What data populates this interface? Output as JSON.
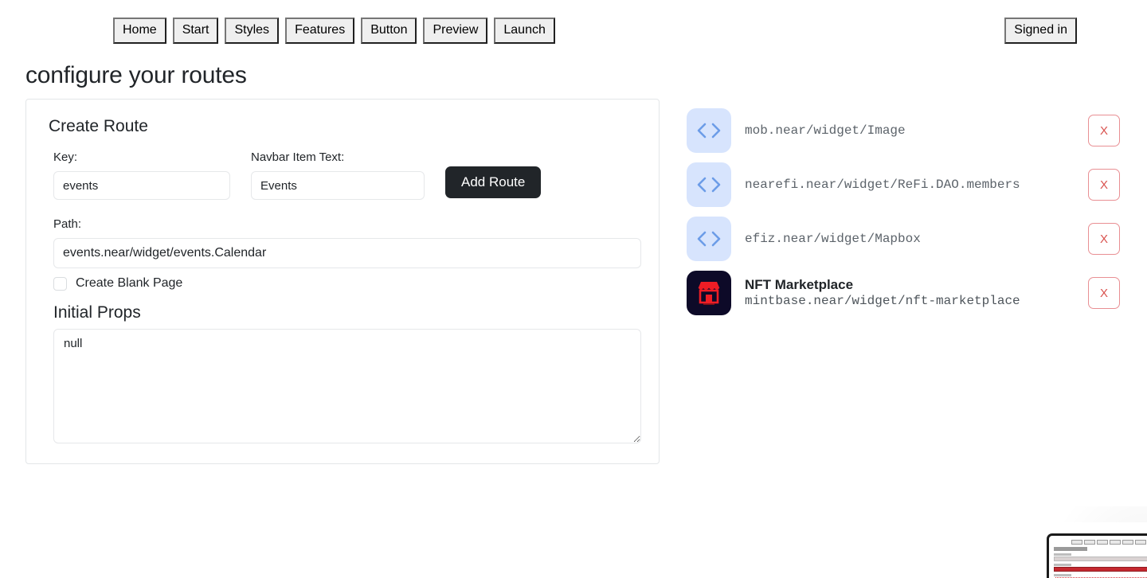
{
  "nav": {
    "items": [
      {
        "label": "Home"
      },
      {
        "label": "Start"
      },
      {
        "label": "Styles"
      },
      {
        "label": "Features"
      },
      {
        "label": "Button"
      },
      {
        "label": "Preview"
      },
      {
        "label": "Launch"
      }
    ],
    "auth_label": "Signed in"
  },
  "page": {
    "title": "configure your routes"
  },
  "create_route": {
    "card_title": "Create Route",
    "key_label": "Key:",
    "key_value": "events",
    "key_placeholder": "",
    "navbar_label": "Navbar Item Text:",
    "navbar_value": "Events",
    "navbar_placeholder": "",
    "add_button": "Add Route",
    "path_label": "Path:",
    "path_value": "events.near/widget/events.Calendar",
    "path_placeholder": "",
    "blank_page_label": "Create Blank Page",
    "blank_page_checked": false,
    "initial_props_title": "Initial Props",
    "initial_props_value": "null"
  },
  "widgets": {
    "delete_label": "X",
    "items": [
      {
        "icon": "code-icon",
        "name": "",
        "path": "mob.near/widget/Image"
      },
      {
        "icon": "code-icon",
        "name": "",
        "path": "nearefi.near/widget/ReFi.DAO.members"
      },
      {
        "icon": "code-icon",
        "name": "",
        "path": "efiz.near/widget/Mapbox"
      },
      {
        "icon": "storefront-icon",
        "name": "NFT Marketplace",
        "path": "mintbase.near/widget/nft-marketplace"
      }
    ]
  },
  "colors": {
    "accent_dark": "#212529",
    "code_icon_bg": "#d7e4fd",
    "code_icon_fg": "#6c9ce8",
    "nft_icon_bg": "#0d0a28",
    "nft_icon_fg": "#ee1d25",
    "delete_border": "#e98f93",
    "delete_text": "#d9534f"
  }
}
